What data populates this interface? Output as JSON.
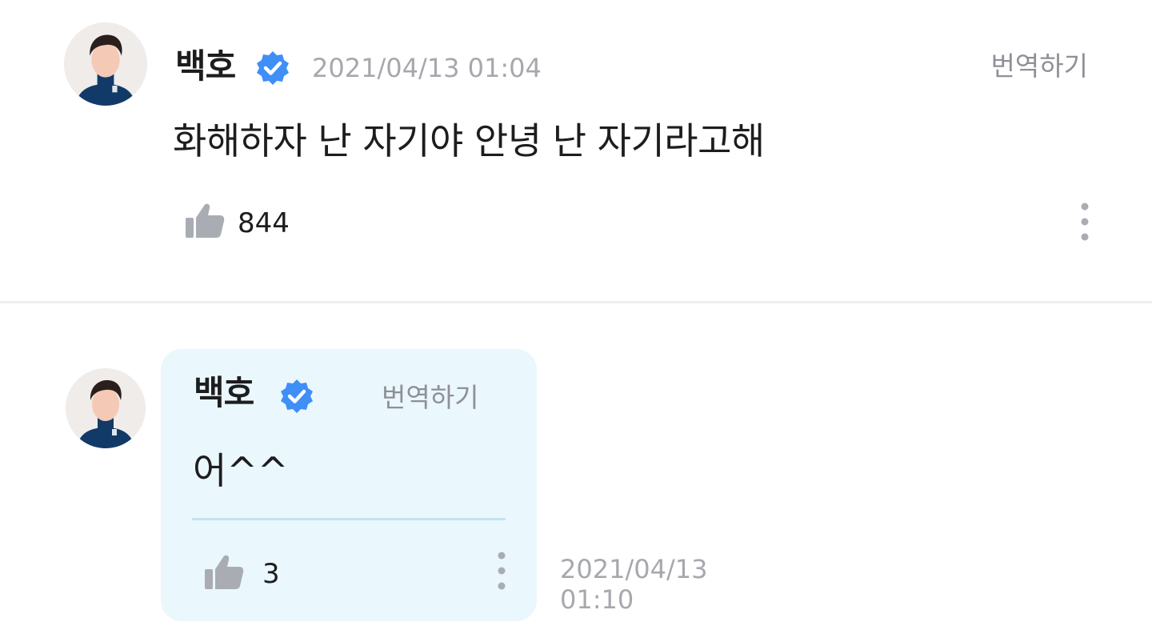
{
  "posts": [
    {
      "author": "백호",
      "verified": true,
      "timestamp": "2021/04/13 01:04",
      "translate_label": "번역하기",
      "body": "화해하자 난 자기야 안녕 난 자기라고해",
      "likes": "844",
      "icons": [
        "avatar",
        "verified-badge-icon",
        "thumbs-up-icon",
        "more-vertical-icon"
      ]
    }
  ],
  "reply": {
    "author": "백호",
    "verified": true,
    "translate_label": "번역하기",
    "body": "어^^",
    "likes": "3",
    "timestamp_date": "2021/04/13",
    "timestamp_time": "01:10",
    "icons": [
      "avatar",
      "verified-badge-icon",
      "thumbs-up-icon",
      "more-vertical-icon"
    ]
  },
  "colors": {
    "verified_badge": "#3f8ff7",
    "reply_card_bg": "#eaf7fd",
    "muted_text": "#a6a8ad",
    "icon_gray": "#a9adb3",
    "divider": "#eeeef0"
  }
}
